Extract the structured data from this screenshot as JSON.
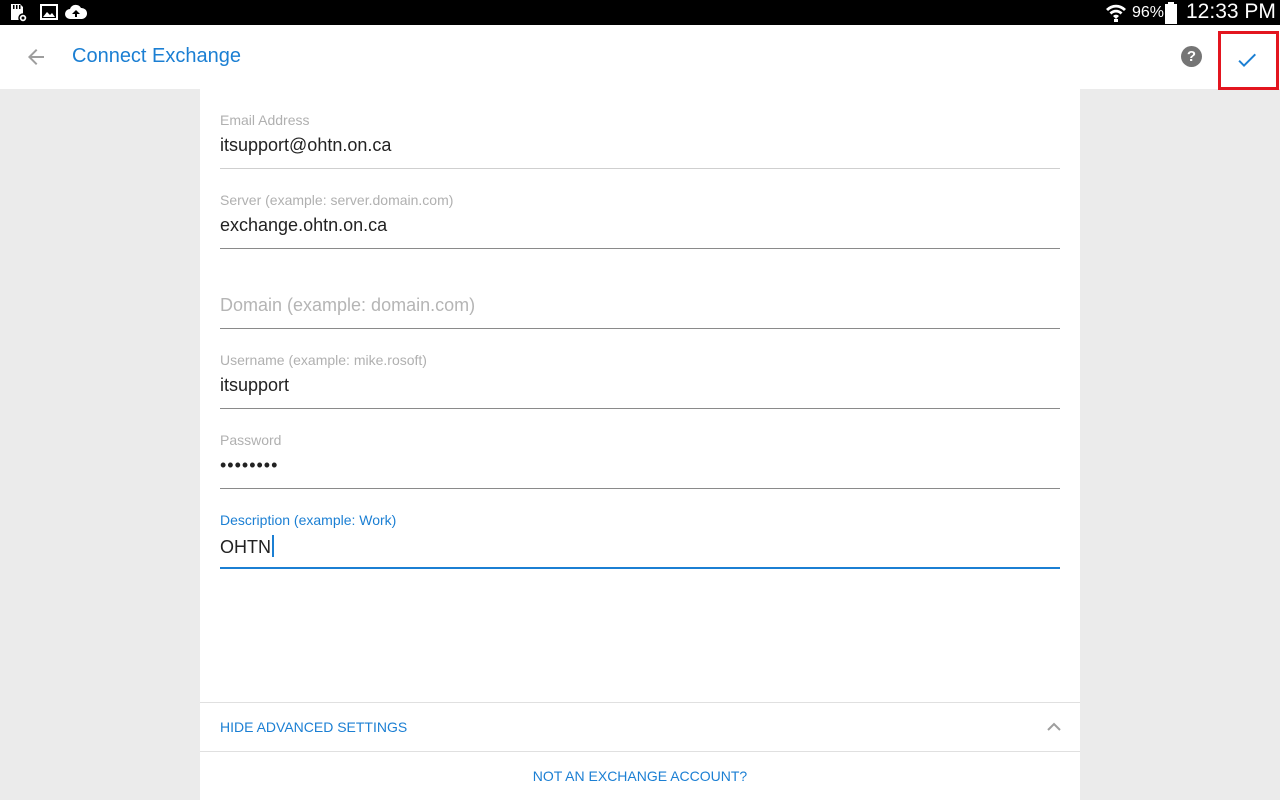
{
  "status_bar": {
    "icons": [
      "sd-card-settings-icon",
      "image-icon",
      "cloud-upload-icon",
      "wifi-icon",
      "battery-icon"
    ],
    "battery_percent": "96%",
    "time": "12:33 PM"
  },
  "app_bar": {
    "title": "Connect Exchange",
    "help_glyph": "?",
    "accent_color": "#1b7fd3",
    "highlight_color": "#e3151f"
  },
  "form": {
    "email": {
      "label": "Email Address",
      "value": "itsupport@ohtn.on.ca"
    },
    "server": {
      "label": "Server (example: server.domain.com)",
      "value": "exchange.ohtn.on.ca"
    },
    "domain": {
      "placeholder": "Domain (example: domain.com)"
    },
    "username": {
      "label": "Username (example: mike.rosoft)",
      "value": "itsupport"
    },
    "password": {
      "label": "Password",
      "value": "••••••••"
    },
    "description": {
      "label": "Description (example: Work)",
      "value": "OHTN"
    }
  },
  "footer": {
    "advanced_toggle": "HIDE ADVANCED SETTINGS",
    "not_exchange": "NOT AN EXCHANGE ACCOUNT?"
  }
}
